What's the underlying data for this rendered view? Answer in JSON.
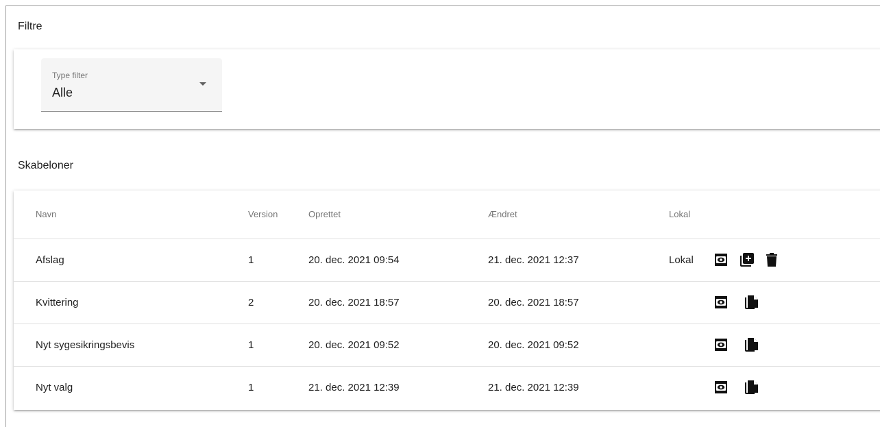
{
  "filters": {
    "section_title": "Filtre",
    "type_filter": {
      "label": "Type filter",
      "value": "Alle"
    }
  },
  "templates": {
    "section_title": "Skabeloner",
    "columns": [
      "Navn",
      "Version",
      "Oprettet",
      "Ændret",
      "Lokal"
    ],
    "rows": [
      {
        "name": "Afslag",
        "version": "1",
        "created": "20. dec. 2021 09:54",
        "changed": "21. dec. 2021 12:37",
        "local": "Lokal",
        "actions": [
          "view-icon",
          "add-copy-icon",
          "delete-icon"
        ]
      },
      {
        "name": "Kvittering",
        "version": "2",
        "created": "20. dec. 2021 18:57",
        "changed": "20. dec. 2021 18:57",
        "local": "",
        "actions": [
          "view-icon",
          "copy-icon"
        ]
      },
      {
        "name": "Nyt sygesikringsbevis",
        "version": "1",
        "created": "20. dec. 2021 09:52",
        "changed": "20. dec. 2021 09:52",
        "local": "",
        "actions": [
          "view-icon",
          "copy-icon"
        ]
      },
      {
        "name": "Nyt valg",
        "version": "1",
        "created": "21. dec. 2021 12:39",
        "changed": "21. dec. 2021 12:39",
        "local": "",
        "actions": [
          "view-icon",
          "copy-icon"
        ]
      }
    ]
  }
}
